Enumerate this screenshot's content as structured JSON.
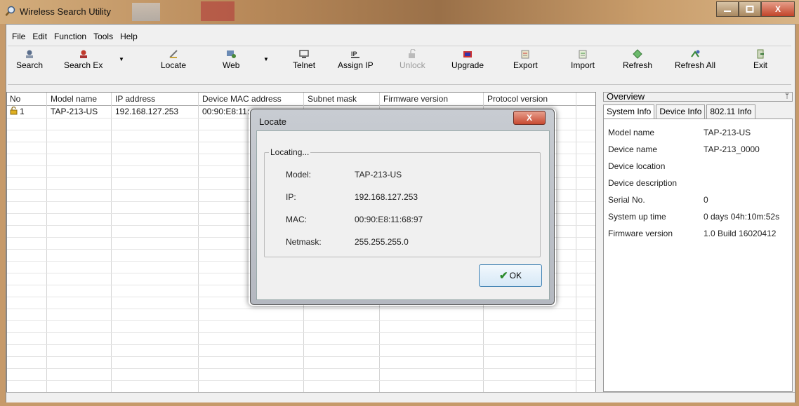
{
  "window": {
    "title": "Wireless Search Utility"
  },
  "menu": [
    "File",
    "Edit",
    "Function",
    "Tools",
    "Help"
  ],
  "toolbar": [
    {
      "label": "Search",
      "icon": "search-user-icon"
    },
    {
      "label": "Search Ex",
      "icon": "search-ex-icon"
    },
    {
      "label": "Locate",
      "icon": "locate-icon"
    },
    {
      "label": "Web",
      "icon": "web-icon"
    },
    {
      "label": "Telnet",
      "icon": "telnet-icon"
    },
    {
      "label": "Assign IP",
      "icon": "assign-ip-icon"
    },
    {
      "label": "Unlock",
      "icon": "unlock-icon",
      "disabled": true
    },
    {
      "label": "Upgrade",
      "icon": "upgrade-icon"
    },
    {
      "label": "Export",
      "icon": "export-icon"
    },
    {
      "label": "Import",
      "icon": "import-icon"
    },
    {
      "label": "Refresh",
      "icon": "refresh-icon"
    },
    {
      "label": "Refresh All",
      "icon": "refresh-all-icon"
    },
    {
      "label": "Exit",
      "icon": "exit-icon"
    }
  ],
  "table": {
    "headers": [
      "No",
      "Model name",
      "IP address",
      "Device MAC address",
      "Subnet mask",
      "Firmware version",
      "Protocol version"
    ],
    "rows": [
      {
        "no": "1",
        "model": "TAP-213-US",
        "ip": "192.168.127.253",
        "mac": "00:90:E8:11:"
      }
    ]
  },
  "overview": {
    "title": "Overview",
    "tabs": [
      "System Info",
      "Device Info",
      "802.11 Info"
    ],
    "fields": [
      {
        "k": "Model name",
        "v": "TAP-213-US"
      },
      {
        "k": "Device name",
        "v": "TAP-213_0000"
      },
      {
        "k": "Device location",
        "v": ""
      },
      {
        "k": "Device description",
        "v": ""
      },
      {
        "k": "Serial No.",
        "v": "0"
      },
      {
        "k": "System up time",
        "v": "0 days 04h:10m:52s"
      },
      {
        "k": "Firmware version",
        "v": "1.0 Build 16020412"
      }
    ]
  },
  "dialog": {
    "title": "Locate",
    "group": "Locating...",
    "fields": [
      {
        "k": "Model:",
        "v": "TAP-213-US"
      },
      {
        "k": "IP:",
        "v": "192.168.127.253"
      },
      {
        "k": "MAC:",
        "v": "00:90:E8:11:68:97"
      },
      {
        "k": "Netmask:",
        "v": "255.255.255.0"
      }
    ],
    "ok_label": "OK"
  },
  "close_symbol": "X"
}
